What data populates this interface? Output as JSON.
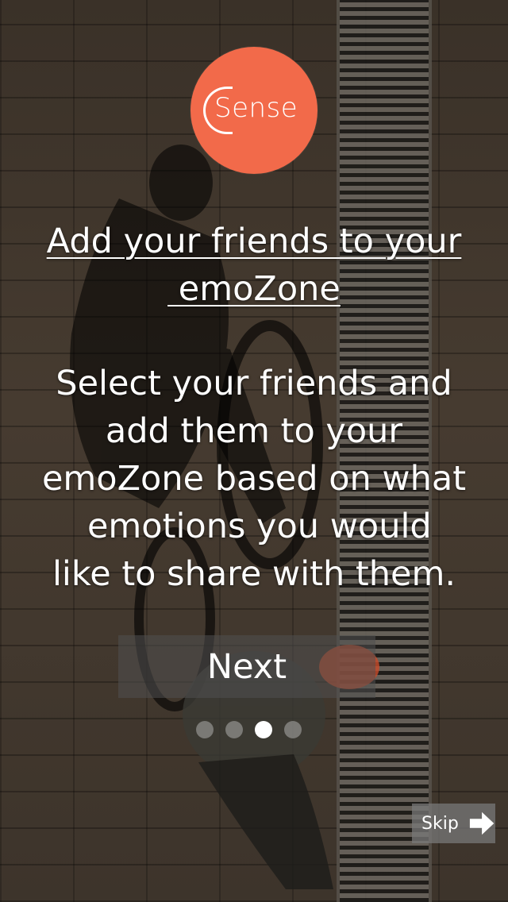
{
  "logo": {
    "text": "Sense"
  },
  "onboarding": {
    "title_line1": "Add your friends to your",
    "title_line2": " emoZone",
    "description_lines": [
      "Select your friends and",
      "add them to your",
      "emoZone based on what",
      " emotions you would",
      "like to share with them."
    ]
  },
  "buttons": {
    "next_label": "Next",
    "skip_label": "Skip"
  },
  "pagination": {
    "total": 4,
    "active_index": 2
  },
  "colors": {
    "logo_circle": "#f26a4a",
    "text": "#ffffff"
  },
  "icons": {
    "skip": "arrow-right-icon"
  }
}
